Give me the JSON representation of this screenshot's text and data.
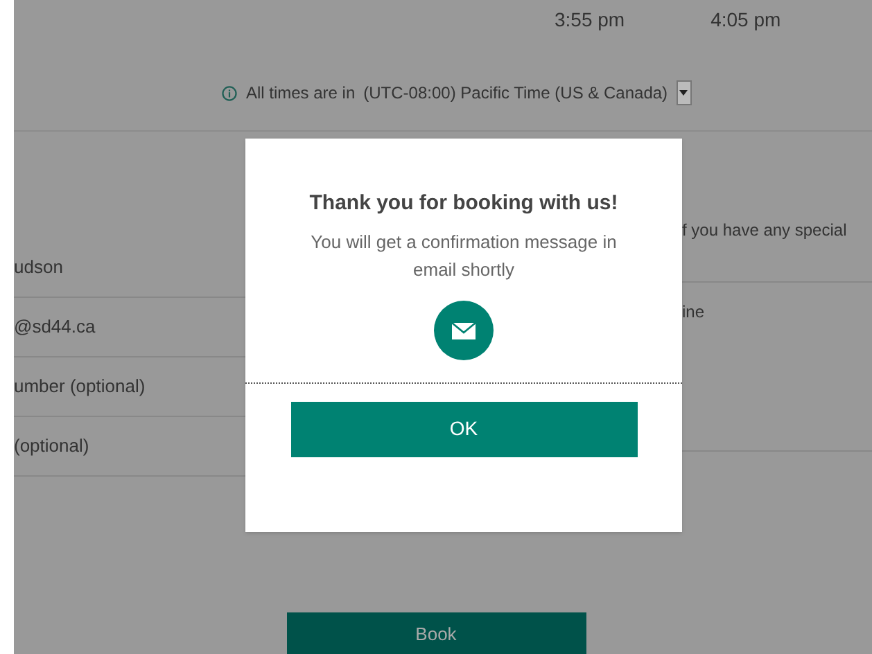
{
  "time_slots": [
    "3:55 pm",
    "4:05 pm"
  ],
  "timezone_note": {
    "label": "All times are in",
    "timezone": "(UTC-08:00) Pacific Time (US & Canada)"
  },
  "form_fields": [
    "udson",
    "@sd44.ca",
    "umber (optional)",
    "(optional)"
  ],
  "notes": {
    "hint": "f you have any special",
    "value": "ine"
  },
  "book_button": "Book",
  "dialog": {
    "title": "Thank you for booking with us!",
    "message": "You will get a confirmation message in email shortly",
    "ok_button": "OK"
  }
}
